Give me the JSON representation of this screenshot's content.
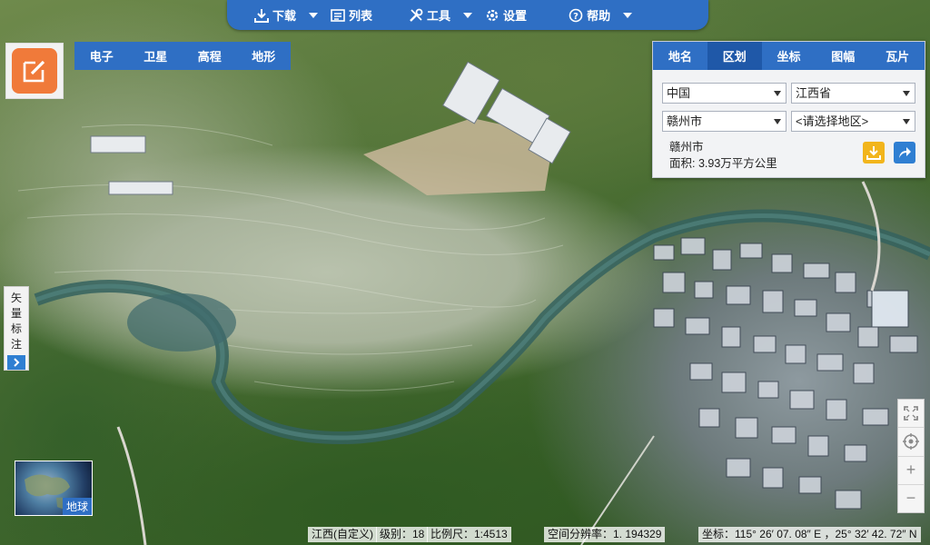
{
  "toolbar": {
    "download": "下载",
    "list": "列表",
    "tools": "工具",
    "settings": "设置",
    "help": "帮助"
  },
  "map_types": [
    "电子",
    "卫星",
    "高程",
    "地形"
  ],
  "panel": {
    "tabs": [
      "地名",
      "区划",
      "坐标",
      "图幅",
      "瓦片"
    ],
    "active_tab": "区划",
    "selects": {
      "country": "中国",
      "province": "江西省",
      "city": "赣州市",
      "district": "<请选择地区>"
    },
    "info_name": "赣州市",
    "info_area": "面积: 3.93万平方公里"
  },
  "side_toggle": {
    "chars": [
      "矢",
      "量",
      "标",
      "注"
    ]
  },
  "globe_label": "地球",
  "status": {
    "region": "江西(自定义)",
    "level": "级别：18",
    "scale": "比例尺：1:4513",
    "resolution": "空间分辨率：1. 194329",
    "coord": "坐标：115° 26′ 07. 08″ E ，25° 32′ 42. 72″ N"
  },
  "colors": {
    "toolbar_blue": "#2f6fc4",
    "edit_orange": "#f07a3a",
    "download_yellow": "#f2b51c",
    "share_blue": "#2f7fd2"
  }
}
